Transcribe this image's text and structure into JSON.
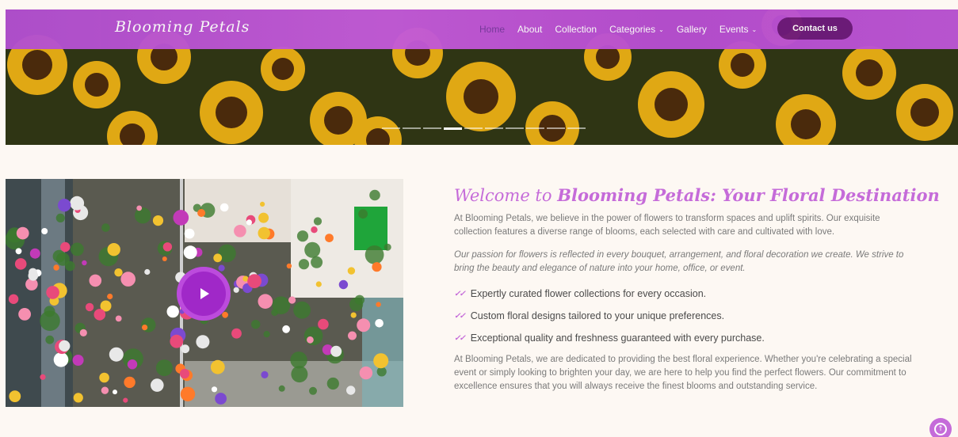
{
  "brand": {
    "name": "Blooming Petals"
  },
  "nav": {
    "items": [
      {
        "label": "Home",
        "active": true,
        "dropdown": false
      },
      {
        "label": "About",
        "active": false,
        "dropdown": false
      },
      {
        "label": "Collection",
        "active": false,
        "dropdown": false
      },
      {
        "label": "Categories",
        "active": false,
        "dropdown": true
      },
      {
        "label": "Gallery",
        "active": false,
        "dropdown": false
      },
      {
        "label": "Events",
        "active": false,
        "dropdown": true
      }
    ],
    "contact_label": "Contact us",
    "caret_glyph": "⌄"
  },
  "carousel": {
    "slide_count": 10,
    "active_index": 3
  },
  "main": {
    "heading_prefix": "Welcome to",
    "heading_bold": "Blooming Petals: Your Floral Destination",
    "intro": "At Blooming Petals, we believe in the power of flowers to transform spaces and uplift spirits. Our exquisite collection features a diverse range of blooms, each selected with care and cultivated with love.",
    "passion": "Our passion for flowers is reflected in every bouquet, arrangement, and floral decoration we create. We strive to bring the beauty and elegance of nature into your home, office, or event.",
    "features": [
      "Expertly curated flower collections for every occasion.",
      "Custom floral designs tailored to your unique preferences.",
      "Exceptional quality and freshness guaranteed with every purchase."
    ],
    "closing": "At Blooming Petals, we are dedicated to providing the best floral experience. Whether you're celebrating a special event or simply looking to brighten your day, we are here to help you find the perfect flowers. Our commitment to excellence ensures that you will always receive the finest blooms and outstanding service."
  },
  "icons": {
    "play": "play-icon",
    "check": "double-check-icon",
    "scroll_top": "arrow-up-circle-icon"
  },
  "colors": {
    "accent": "#c56bd9",
    "nav_bar": "#b84ed2",
    "contact_button": "#6e1a7c",
    "play_button": "#a028c8",
    "background": "#fdf8f3"
  }
}
